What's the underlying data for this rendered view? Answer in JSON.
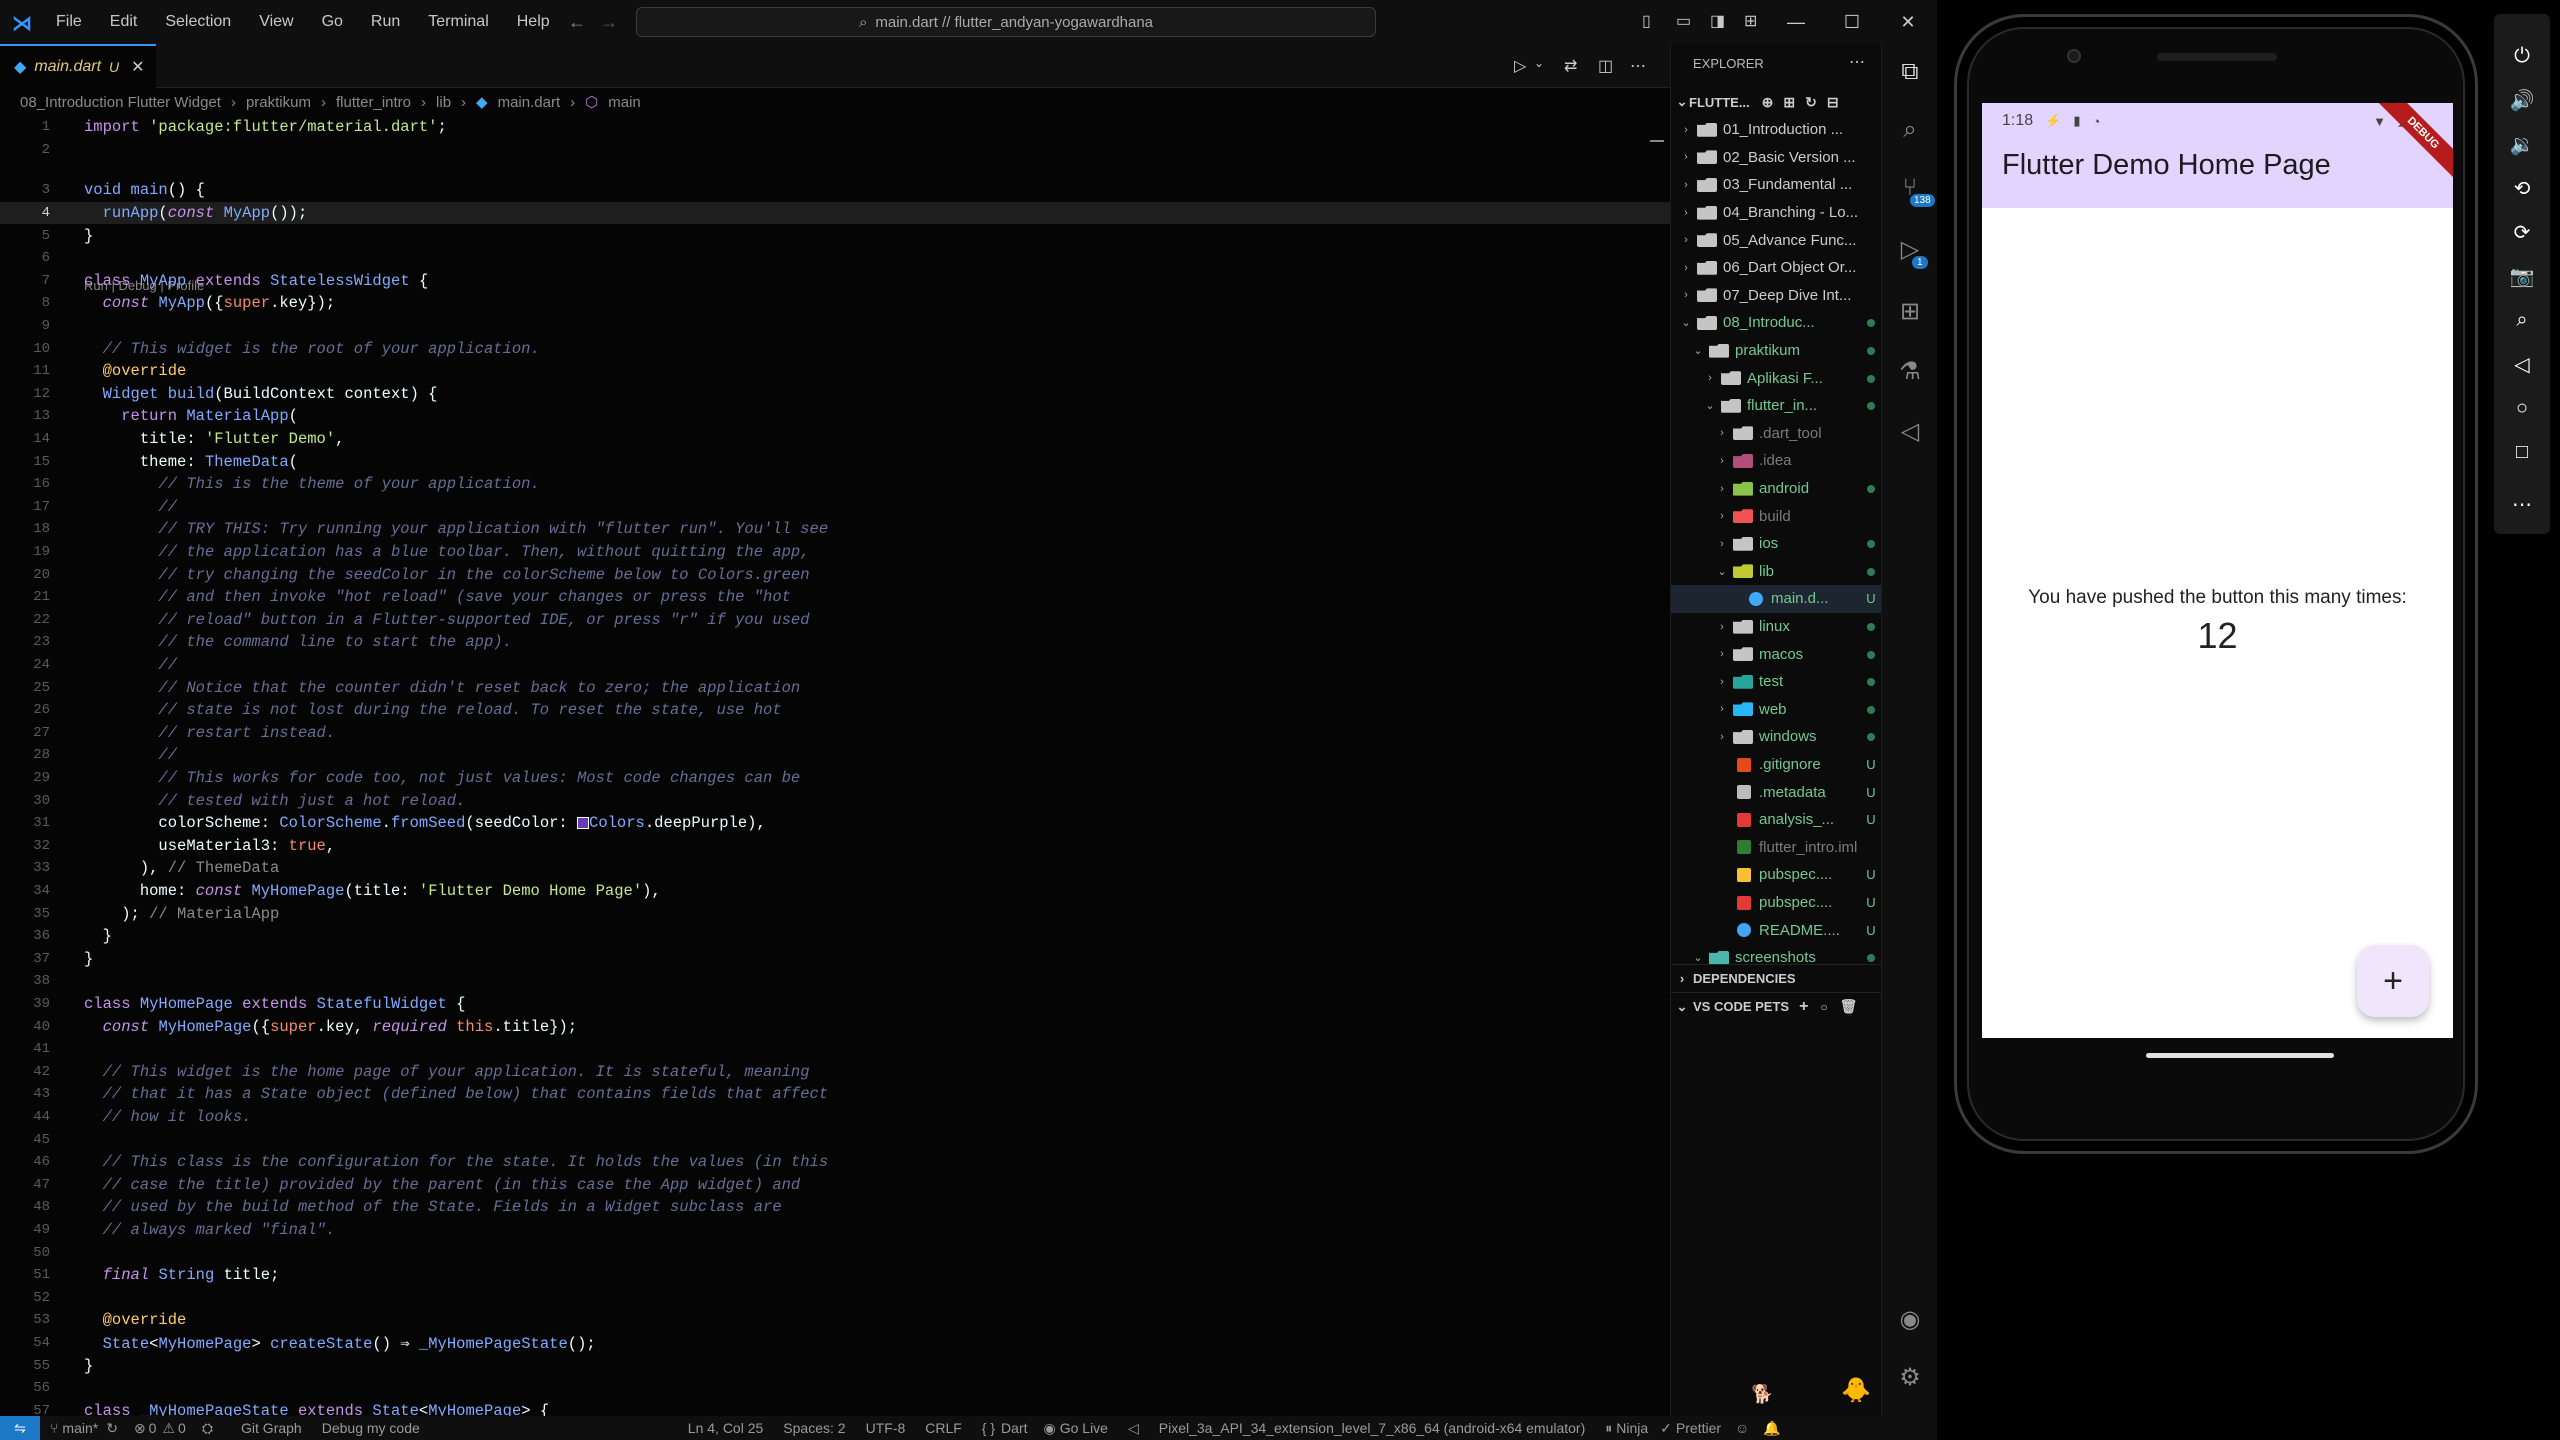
{
  "titlebar": {
    "menu": [
      "File",
      "Edit",
      "Selection",
      "View",
      "Go",
      "Run",
      "Terminal",
      "Help"
    ],
    "search": "main.dart // flutter_andyan-yogawardhana"
  },
  "tab": {
    "name": "main.dart",
    "status": "U"
  },
  "breadcrumb": [
    "08_Introduction Flutter Widget",
    "praktikum",
    "flutter_intro",
    "lib",
    "main.dart",
    "main"
  ],
  "codelens": "Run | Debug | Profile",
  "code": [
    {
      "n": "1",
      "html": "<span class='kw2'>import</span> <span class='str2'>'package:flutter/material.dart'</span><span class='pl'>;</span>"
    },
    {
      "n": "2",
      "html": ""
    },
    {
      "n": "3",
      "html": "<span class='ty2'>void</span> <span class='fn2'>main</span><span class='pl'>() {</span>"
    },
    {
      "n": "4",
      "html": "  <span class='fn2'>runApp</span><span class='pl'>(</span><span class='kw2' style='font-style:italic'>const</span> <span class='ty2'>MyApp</span><span class='pl'>());</span>",
      "cur": true
    },
    {
      "n": "5",
      "html": "<span class='pl'>}</span>"
    },
    {
      "n": "6",
      "html": ""
    },
    {
      "n": "7",
      "html": "<span class='kw2'>class</span> <span class='ty2'>MyApp</span> <span class='kw2'>extends</span> <span class='ty2'>StatelessWidget</span> <span class='pl'>{</span>"
    },
    {
      "n": "8",
      "html": "  <span class='kw2' style='font-style:italic'>const</span> <span class='ty2'>MyApp</span><span class='pl'>({</span><span class='pr2'>super</span><span class='pl'>.key});</span>"
    },
    {
      "n": "9",
      "html": ""
    },
    {
      "n": "10",
      "html": "  <span class='cm2'>// This widget is the root of your application.</span>"
    },
    {
      "n": "11",
      "html": "  <span class='an2'>@override</span>"
    },
    {
      "n": "12",
      "html": "  <span class='ty2'>Widget</span> <span class='fn2'>build</span><span class='pl'>(BuildContext context) {</span>"
    },
    {
      "n": "13",
      "html": "    <span class='kw2'>return</span> <span class='ty2'>MaterialApp</span><span class='pl'>(</span>"
    },
    {
      "n": "14",
      "html": "      <span class='pl'>title: </span><span class='str2'>'Flutter Demo'</span><span class='pl'>,</span>"
    },
    {
      "n": "15",
      "html": "      <span class='pl'>theme: </span><span class='ty2'>ThemeData</span><span class='pl'>(</span>"
    },
    {
      "n": "16",
      "html": "        <span class='cm2'>// This is the theme of your application.</span>"
    },
    {
      "n": "17",
      "html": "        <span class='cm2'>//</span>"
    },
    {
      "n": "18",
      "html": "        <span class='cm2'>// TRY THIS: Try running your application with \"flutter run\". You'll see</span>"
    },
    {
      "n": "19",
      "html": "        <span class='cm2'>// the application has a blue toolbar. Then, without quitting the app,</span>"
    },
    {
      "n": "20",
      "html": "        <span class='cm2'>// try changing the seedColor in the colorScheme below to Colors.green</span>"
    },
    {
      "n": "21",
      "html": "        <span class='cm2'>// and then invoke \"hot reload\" (save your changes or press the \"hot</span>"
    },
    {
      "n": "22",
      "html": "        <span class='cm2'>// reload\" button in a Flutter-supported IDE, or press \"r\" if you used</span>"
    },
    {
      "n": "23",
      "html": "        <span class='cm2'>// the command line to start the app).</span>"
    },
    {
      "n": "24",
      "html": "        <span class='cm2'>//</span>"
    },
    {
      "n": "25",
      "html": "        <span class='cm2'>// Notice that the counter didn't reset back to zero; the application</span>"
    },
    {
      "n": "26",
      "html": "        <span class='cm2'>// state is not lost during the reload. To reset the state, use hot</span>"
    },
    {
      "n": "27",
      "html": "        <span class='cm2'>// restart instead.</span>"
    },
    {
      "n": "28",
      "html": "        <span class='cm2'>//</span>"
    },
    {
      "n": "29",
      "html": "        <span class='cm2'>// This works for code too, not just values: Most code changes can be</span>"
    },
    {
      "n": "30",
      "html": "        <span class='cm2'>// tested with just a hot reload.</span>"
    },
    {
      "n": "31",
      "html": "        <span class='pl'>colorScheme: </span><span class='ty2'>ColorScheme</span><span class='pl'>.</span><span class='fn2'>fromSeed</span><span class='pl'>(seedColor: </span><span style='display:inline-block;width:12px;height:12px;background:#673ab7;border:1px solid #fff;vertical-align:middle'></span><span class='ty2'>Colors</span><span class='pl'>.deepPurple),</span>"
    },
    {
      "n": "32",
      "html": "        <span class='pl'>useMaterial3: </span><span class='pr2'>true</span><span class='pl'>,</span>"
    },
    {
      "n": "33",
      "html": "      <span class='pl'>), </span><span class='pl' style='color:#8a8a8a'>// ThemeData</span>"
    },
    {
      "n": "34",
      "html": "      <span class='pl'>home: </span><span class='kw2' style='font-style:italic'>const</span> <span class='ty2'>MyHomePage</span><span class='pl'>(title: </span><span class='str2'>'Flutter Demo Home Page'</span><span class='pl'>),</span>"
    },
    {
      "n": "35",
      "html": "    <span class='pl'>); </span><span class='pl' style='color:#8a8a8a'>// MaterialApp</span>"
    },
    {
      "n": "36",
      "html": "  <span class='pl'>}</span>"
    },
    {
      "n": "37",
      "html": "<span class='pl'>}</span>"
    },
    {
      "n": "38",
      "html": ""
    },
    {
      "n": "39",
      "html": "<span class='kw2'>class</span> <span class='ty2'>MyHomePage</span> <span class='kw2'>extends</span> <span class='ty2'>StatefulWidget</span> <span class='pl'>{</span>"
    },
    {
      "n": "40",
      "html": "  <span class='kw2' style='font-style:italic'>const</span> <span class='ty2'>MyHomePage</span><span class='pl'>({</span><span class='pr2'>super</span><span class='pl'>.key, </span><span class='kw2' style='font-style:italic'>required</span> <span class='pr2'>this</span><span class='pl'>.title});</span>"
    },
    {
      "n": "41",
      "html": ""
    },
    {
      "n": "42",
      "html": "  <span class='cm2'>// This widget is the home page of your application. It is stateful, meaning</span>"
    },
    {
      "n": "43",
      "html": "  <span class='cm2'>// that it has a State object (defined below) that contains fields that affect</span>"
    },
    {
      "n": "44",
      "html": "  <span class='cm2'>// how it looks.</span>"
    },
    {
      "n": "45",
      "html": ""
    },
    {
      "n": "46",
      "html": "  <span class='cm2'>// This class is the configuration for the state. It holds the values (in this</span>"
    },
    {
      "n": "47",
      "html": "  <span class='cm2'>// case the title) provided by the parent (in this case the App widget) and</span>"
    },
    {
      "n": "48",
      "html": "  <span class='cm2'>// used by the build method of the State. Fields in a Widget subclass are</span>"
    },
    {
      "n": "49",
      "html": "  <span class='cm2'>// always marked \"final\".</span>"
    },
    {
      "n": "50",
      "html": ""
    },
    {
      "n": "51",
      "html": "  <span class='kw2' style='font-style:italic'>final</span> <span class='ty2'>String</span> <span class='pl'>title;</span>"
    },
    {
      "n": "52",
      "html": ""
    },
    {
      "n": "53",
      "html": "  <span class='an2'>@override</span>"
    },
    {
      "n": "54",
      "html": "  <span class='ty2'>State</span><span class='pl'>&lt;</span><span class='ty2'>MyHomePage</span><span class='pl'>&gt; </span><span class='fn2'>createState</span><span class='pl'>() ⇒ </span><span class='ty2'>_MyHomePageState</span><span class='pl'>();</span>"
    },
    {
      "n": "55",
      "html": "<span class='pl'>}</span>"
    },
    {
      "n": "56",
      "html": ""
    },
    {
      "n": "57",
      "html": "<span class='kw2'>class</span> <span class='ty2'>_MyHomePageState</span> <span class='kw2'>extends</span> <span class='ty2'>State</span><span class='pl'>&lt;</span><span class='ty2'>MyHomePage</span><span class='pl'>&gt; {</span>"
    }
  ],
  "explorer": {
    "title": "EXPLORER",
    "root": "FLUTTE...",
    "items": [
      {
        "label": "01_Introduction ...",
        "depth": 1,
        "type": "folder",
        "chev": "›",
        "status": ""
      },
      {
        "label": "02_Basic Version ...",
        "depth": 1,
        "type": "folder",
        "chev": "›",
        "status": ""
      },
      {
        "label": "03_Fundamental ...",
        "depth": 1,
        "type": "folder",
        "chev": "›",
        "status": ""
      },
      {
        "label": "04_Branching - Lo...",
        "depth": 1,
        "type": "folder",
        "chev": "›",
        "status": ""
      },
      {
        "label": "05_Advance Func...",
        "depth": 1,
        "type": "folder",
        "chev": "›",
        "status": ""
      },
      {
        "label": "06_Dart Object Or...",
        "depth": 1,
        "type": "folder",
        "chev": "›",
        "status": ""
      },
      {
        "label": "07_Deep Dive Int...",
        "depth": 1,
        "type": "folder",
        "chev": "›",
        "status": ""
      },
      {
        "label": "08_Introduc...",
        "depth": 1,
        "type": "folder-open",
        "chev": "⌄",
        "status": "dot"
      },
      {
        "label": "praktikum",
        "depth": 2,
        "type": "folder-open",
        "chev": "⌄",
        "status": "dot"
      },
      {
        "label": "Aplikasi F...",
        "depth": 3,
        "type": "folder",
        "chev": "›",
        "status": "dot"
      },
      {
        "label": "flutter_in...",
        "depth": 3,
        "type": "folder-open",
        "chev": "⌄",
        "status": "dot"
      },
      {
        "label": ".dart_tool",
        "depth": 4,
        "type": "folder",
        "chev": "›",
        "status": "",
        "dim": true
      },
      {
        "label": ".idea",
        "depth": 4,
        "type": "folder-idea",
        "chev": "›",
        "status": "",
        "dim": true
      },
      {
        "label": "android",
        "depth": 4,
        "type": "folder-android",
        "chev": "›",
        "status": "dot"
      },
      {
        "label": "build",
        "depth": 4,
        "type": "folder-build",
        "chev": "›",
        "status": "",
        "dim": true
      },
      {
        "label": "ios",
        "depth": 4,
        "type": "folder",
        "chev": "›",
        "status": "dot"
      },
      {
        "label": "lib",
        "depth": 4,
        "type": "folder-lib",
        "chev": "⌄",
        "status": "dot"
      },
      {
        "label": "main.d...",
        "depth": 5,
        "type": "dart",
        "chev": "",
        "status": "U",
        "selected": true
      },
      {
        "label": "linux",
        "depth": 4,
        "type": "folder",
        "chev": "›",
        "status": "dot"
      },
      {
        "label": "macos",
        "depth": 4,
        "type": "folder",
        "chev": "›",
        "status": "dot"
      },
      {
        "label": "test",
        "depth": 4,
        "type": "folder-test",
        "chev": "›",
        "status": "dot"
      },
      {
        "label": "web",
        "depth": 4,
        "type": "folder-web",
        "chev": "›",
        "status": "dot"
      },
      {
        "label": "windows",
        "depth": 4,
        "type": "folder",
        "chev": "›",
        "status": "dot"
      },
      {
        "label": ".gitignore",
        "depth": 4,
        "type": "git",
        "chev": "",
        "status": "U"
      },
      {
        "label": ".metadata",
        "depth": 4,
        "type": "file",
        "chev": "",
        "status": "U"
      },
      {
        "label": "analysis_...",
        "depth": 4,
        "type": "yaml-red",
        "chev": "",
        "status": "U"
      },
      {
        "label": "flutter_intro.iml",
        "depth": 4,
        "type": "iml",
        "chev": "",
        "status": "",
        "dim": true
      },
      {
        "label": "pubspec....",
        "depth": 4,
        "type": "lock",
        "chev": "",
        "status": "U"
      },
      {
        "label": "pubspec....",
        "depth": 4,
        "type": "yaml-red",
        "chev": "",
        "status": "U"
      },
      {
        "label": "README....",
        "depth": 4,
        "type": "info",
        "chev": "",
        "status": "U"
      },
      {
        "label": "screenshots",
        "depth": 2,
        "type": "folder-teal",
        "chev": "⌄",
        "status": "dot"
      }
    ],
    "dependencies": "DEPENDENCIES",
    "pets": "VS CODE PETS"
  },
  "activity": {
    "source_control_badge": "138",
    "debug_badge": "1"
  },
  "statusbar": {
    "branch": "main*",
    "problems_errors": "0",
    "problems_warnings": "0",
    "git_graph": "Git Graph",
    "debug_code": "Debug my code",
    "position": "Ln 4, Col 25",
    "spaces": "Spaces: 2",
    "encoding": "UTF-8",
    "eol": "CRLF",
    "language": "Dart",
    "golive": "Go Live",
    "device": "Pixel_3a_API_34_extension_level_7_x86_64 (android-x64 emulator)",
    "ninja": "Ninja",
    "prettier": "Prettier"
  },
  "phone": {
    "time": "1:18",
    "debug": "DEBUG",
    "app_title": "Flutter Demo Home Page",
    "counter_label": "You have pushed the button this many times:",
    "counter_value": "12",
    "fab": "+"
  },
  "colors": {
    "accent": "#3794ff",
    "appbar": "#e3d3ff",
    "fab": "#efe6fb"
  }
}
